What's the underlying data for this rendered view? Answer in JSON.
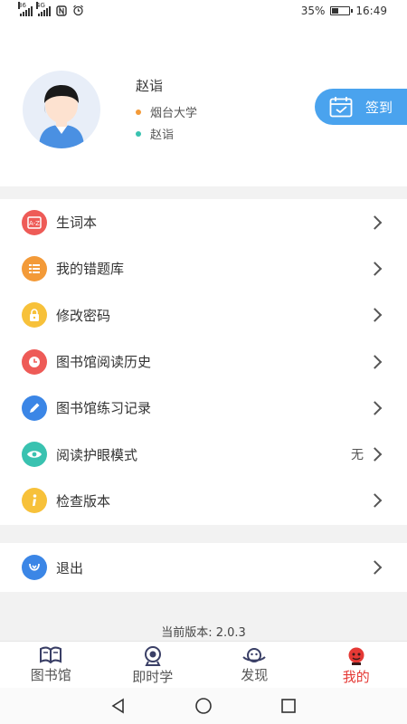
{
  "status_bar": {
    "sig1_label": "36",
    "sig2_label": "4G",
    "battery": "35%",
    "battery_level": 0.35,
    "time": "16:49"
  },
  "profile": {
    "name": "赵诣",
    "school": "烟台大学",
    "nickname": "赵诣",
    "checkin_label": "签到"
  },
  "menu": [
    {
      "label": "生词本",
      "icon": "dictionary-icon",
      "color": "#ee5b57"
    },
    {
      "label": "我的错题库",
      "icon": "list-icon",
      "color": "#f39a38"
    },
    {
      "label": "修改密码",
      "icon": "lock-icon",
      "color": "#f7c13a"
    },
    {
      "label": "图书馆阅读历史",
      "icon": "clock-icon",
      "color": "#ee5b57"
    },
    {
      "label": "图书馆练习记录",
      "icon": "pencil-icon",
      "color": "#3b86e6"
    },
    {
      "label": "阅读护眼模式",
      "icon": "eye-icon",
      "color": "#39c2b0",
      "value": "无"
    },
    {
      "label": "检查版本",
      "icon": "info-icon",
      "color": "#f7c13a"
    }
  ],
  "logout": {
    "label": "退出",
    "icon": "logout-icon",
    "color": "#3b86e6"
  },
  "version_text": "当前版本: 2.0.3",
  "tabs": [
    {
      "label": "图书馆",
      "icon": "book-icon"
    },
    {
      "label": "即时学",
      "icon": "camera-icon"
    },
    {
      "label": "发现",
      "icon": "planet-icon"
    },
    {
      "label": "我的",
      "icon": "profile-icon",
      "active": true
    }
  ],
  "colors": {
    "accent": "#4aa3ee",
    "active_tab": "#e53935",
    "divider": "#f2f2f2"
  }
}
